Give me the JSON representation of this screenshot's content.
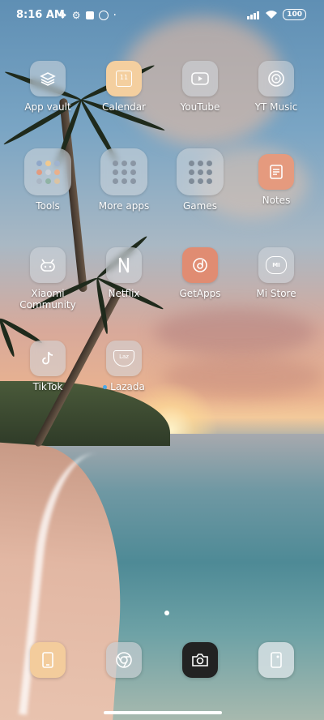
{
  "status_bar": {
    "time": "8:16 AM",
    "battery": "100"
  },
  "apps": [
    {
      "label": "App vault",
      "icon": "app-vault-icon"
    },
    {
      "label": "Calendar",
      "icon": "calendar-icon",
      "day": "11"
    },
    {
      "label": "YouTube",
      "icon": "youtube-icon"
    },
    {
      "label": "YT Music",
      "icon": "yt-music-icon"
    },
    {
      "label": "Tools",
      "icon": "tools-folder-icon"
    },
    {
      "label": "More apps",
      "icon": "more-apps-folder-icon"
    },
    {
      "label": "Games",
      "icon": "games-folder-icon"
    },
    {
      "label": "Notes",
      "icon": "notes-icon"
    },
    {
      "label": "Xiaomi Community",
      "icon": "xiaomi-community-icon"
    },
    {
      "label": "Netflix",
      "icon": "netflix-icon"
    },
    {
      "label": "GetApps",
      "icon": "getapps-icon"
    },
    {
      "label": "Mi Store",
      "icon": "mi-store-icon",
      "logo_text": "MI"
    },
    {
      "label": "TikTok",
      "icon": "tiktok-icon"
    },
    {
      "label": "Lazada",
      "icon": "lazada-icon",
      "logo_text": "Laz"
    }
  ],
  "dock": [
    {
      "icon": "phone-icon"
    },
    {
      "icon": "chrome-icon"
    },
    {
      "icon": "camera-icon"
    },
    {
      "icon": "file-manager-icon"
    }
  ],
  "colors": {
    "calendar_bg": "#f4cf9f",
    "notes_bg": "#e59a7e",
    "getapps_bg": "#e08c72",
    "camera_bg": "#222222",
    "new_badge": "#4aa8e8"
  }
}
